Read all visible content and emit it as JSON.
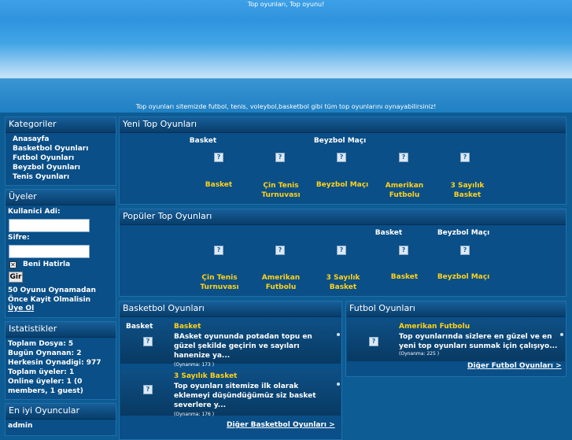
{
  "header": {
    "title": "Top oyunları, Top oyunu!",
    "subtitle": "Top oyunları sitemizde futbol, tenis, voleybol,basketbol gibi tüm top oyunlarını oynayabilirsiniz!"
  },
  "categories": {
    "title": "Kategoriler",
    "items": [
      "Anasayfa",
      "Basketbol Oyunları",
      "Futbol Oyunları",
      "Beyzbol Oyunları",
      "Tenis Oyunları"
    ]
  },
  "members": {
    "title": "Üyeler",
    "username_label": "Kullanici Adi:",
    "password_label": "Sifre:",
    "remember_label": "Beni Hatirla",
    "login_button": "Gir",
    "notice": "50 Oyunu Oynamadan Önce Kayit Olmalisin",
    "register_link": "Üye Ol"
  },
  "stats": {
    "title": "Istatistikler",
    "lines": [
      "Toplam Dosya: 5",
      "Bugün Oynanan: 2",
      "Herkesin Oynadigi: 977",
      "Toplam üyeler: 1",
      "Online üyeler: 1 (0",
      "members, 1 guest)"
    ]
  },
  "best_players": {
    "title": "En iyi Oyuncular",
    "players": [
      "admin"
    ]
  },
  "new_games": {
    "title": "Yeni Top Oyunları",
    "top_labels": [
      "Basket",
      "",
      "Beyzbol Maçı",
      "",
      ""
    ],
    "names": [
      "Basket",
      "Çin Tenis Turnuvası",
      "Beyzbol Maçı",
      "Amerikan Futbolu",
      "3 Sayılık Basket"
    ]
  },
  "popular_games": {
    "title": "Popüler Top Oyunları",
    "top_labels": [
      "",
      "",
      "",
      "Basket",
      "Beyzbol Maçı"
    ],
    "names": [
      "Çin Tenis Turnuvası",
      "Amerikan Futbolu",
      "3 Sayılık Basket",
      "Basket",
      "Beyzbol Maçı"
    ]
  },
  "basketball": {
    "title": "Basketbol Oyunları",
    "thumb_label": "Basket",
    "items": [
      {
        "name": "Basket",
        "description": "BAsket oyununda potadan topu en güzel şekilde geçirin ve sayıları hanenize ya...",
        "plays": "(Oynanma: 173 )"
      },
      {
        "name": "3 Sayılık Basket",
        "description": "Top oyunları sitemize ilk olarak eklemeyi düşündüğümüz siz basket severlere y...",
        "plays": "(Oynanma: 176 )"
      }
    ],
    "more": "Diğer Basketbol Oyunları >"
  },
  "football": {
    "title": "Futbol Oyunları",
    "items": [
      {
        "name": "Amerikan Futbolu",
        "description": "Top oyunlarında sizlere en güzel ve en yeni top oyunları sunmak için çalışıyo...",
        "plays": "(Oynanma: 225 )"
      }
    ],
    "more": "Diğer Futbol Oyunları >"
  },
  "colors": {
    "accent": "#ffd21c",
    "panel": "#0a4f87",
    "page": "#0d5c94"
  }
}
